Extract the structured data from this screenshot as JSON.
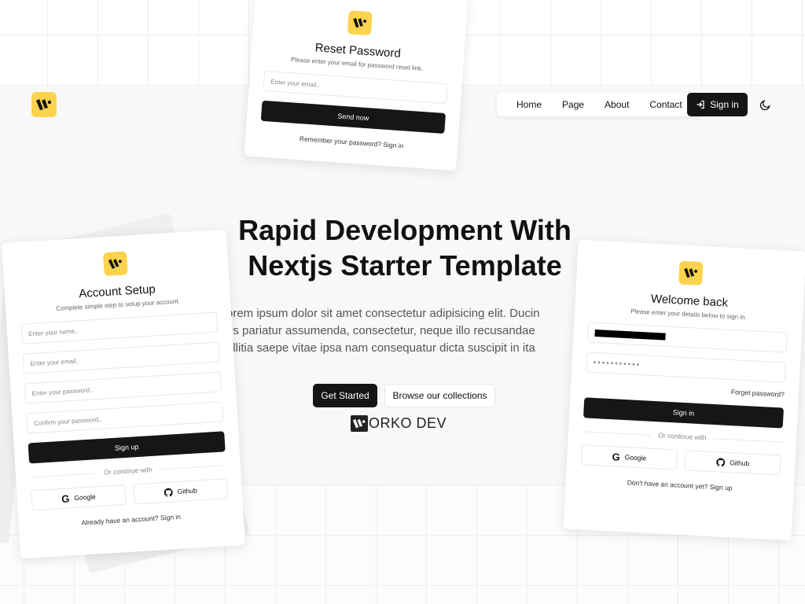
{
  "brand": {
    "name": "Worko Dev",
    "logo_icon": "worko-logo-icon",
    "accent_color": "#fcd34d"
  },
  "nav": {
    "items": [
      {
        "label": "Home"
      },
      {
        "label": "Page"
      },
      {
        "label": "About"
      },
      {
        "label": "Contact"
      }
    ],
    "signin_label": "Sign in",
    "signin_icon": "login-arrow-icon",
    "theme_icon": "moon-icon"
  },
  "hero": {
    "title_line1": "Rapid Development With",
    "title_line2": "Nextjs Starter Template",
    "text_line1": "orem ipsum dolor sit amet consectetur adipisicing elit. Ducin",
    "text_line2": "us pariatur assumenda, consectetur, neque illo recusandae",
    "text_line3": "ollitia saepe vitae ipsa nam consequatur dicta suscipit in ita",
    "cta_primary": "Get Started",
    "cta_secondary": "Browse our collections",
    "wordmark": "ORKO DEV"
  },
  "reset_card": {
    "title": "Reset Password",
    "subtitle": "Please enter your email for password reset link.",
    "email_placeholder": "Enter your email..",
    "submit_label": "Send now",
    "footer": "Remember your password? Sign in"
  },
  "setup_card": {
    "title": "Account Setup",
    "subtitle": "Complete simple step to setup your account.",
    "name_placeholder": "Enter your name..",
    "email_placeholder": "Enter your email..",
    "password_placeholder": "Enter your password..",
    "confirm_placeholder": "Confirm your password..",
    "submit_label": "Sign up",
    "divider": "Or continue with",
    "google_label": "Google",
    "github_label": "Github",
    "footer": "Already have an account? Sign in"
  },
  "login_card": {
    "title": "Welcome back",
    "subtitle": "Please enter your details below to sign in.",
    "email_value": "[redacted]",
    "password_value": "•••••••••••",
    "forgot_label": "Forget password?",
    "submit_label": "Sign in",
    "divider": "Or continue with",
    "google_label": "Google",
    "github_label": "Github",
    "footer": "Don't have an account yet? Sign up"
  }
}
